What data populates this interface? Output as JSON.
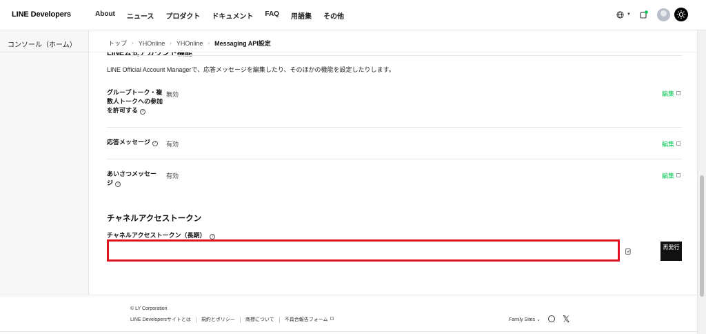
{
  "header": {
    "logo": "LINE Developers",
    "nav": [
      "About",
      "ニュース",
      "プロダクト",
      "ドキュメント",
      "FAQ",
      "用語集",
      "その他"
    ]
  },
  "sidebar": {
    "title": "コンソール（ホーム）"
  },
  "breadcrumb": {
    "items": [
      "トップ",
      "YHOnline",
      "YHOnline"
    ],
    "current": "Messaging API設定"
  },
  "main": {
    "cut_heading": "LINE公式アカウント機能",
    "description": "LINE Official Account Managerで、応答メッセージを編集したり、そのほかの機能を設定したりします。",
    "rows": [
      {
        "label": "グループトーク・複数人トークへの参加を許可する",
        "value": "無効",
        "edit": "編集"
      },
      {
        "label": "応答メッセージ",
        "value": "有効",
        "edit": "編集"
      },
      {
        "label": "あいさつメッセージ",
        "value": "有効",
        "edit": "編集"
      }
    ],
    "help_glyph": "?",
    "token_section": {
      "heading": "チャネルアクセストークン",
      "label": "チャネルアクセストークン（長期）",
      "value": "",
      "reissue_label": "再発行"
    }
  },
  "footer": {
    "copyright": "© LY Corporation",
    "links": [
      "LINE Developersサイトとは",
      "規約とポリシー",
      "商標について",
      "不具合報告フォーム"
    ],
    "family_sites": "Family Sites"
  },
  "colors": {
    "accent_green": "#06c755",
    "highlight_red": "#e0141e",
    "button_dark": "#111111"
  }
}
